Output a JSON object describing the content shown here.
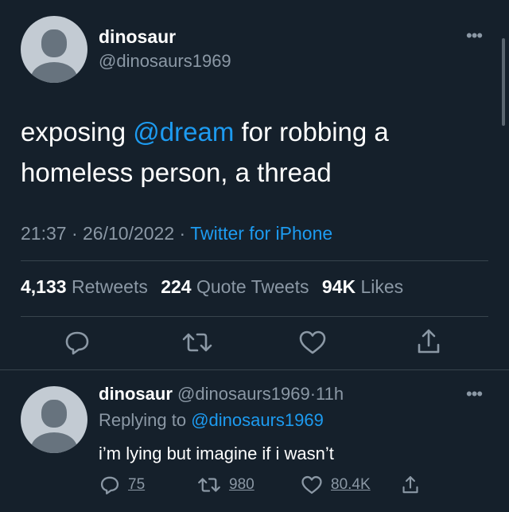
{
  "tweet": {
    "name": "dinosaur",
    "handle": "@dinosaurs1969",
    "text_before": "exposing ",
    "mention": "@dream",
    "text_after": " for robbing a homeless person, a thread",
    "time": "21:37",
    "date": "26/10/2022",
    "sep": "·",
    "source": "Twitter for iPhone",
    "stats": {
      "retweets_count": "4,133",
      "retweets_label": "Retweets",
      "quotes_count": "224",
      "quotes_label": "Quote Tweets",
      "likes_count": "94K",
      "likes_label": "Likes"
    },
    "actions": [
      "reply-icon",
      "retweet-icon",
      "like-icon",
      "share-icon"
    ]
  },
  "reply": {
    "name": "dinosaur",
    "handle": "@dinosaurs1969",
    "sep": "·",
    "age": "11h",
    "replying_label": "Replying to",
    "replying_to": "@dinosaurs1969",
    "text": "i’m lying but imagine if i wasn’t",
    "replies": "75",
    "retweets": "980",
    "likes": "80.4K"
  },
  "colors": {
    "background": "#15202b",
    "accent": "#1d9bf0",
    "secondary_text": "#8b98a5",
    "divider": "#38444d"
  }
}
